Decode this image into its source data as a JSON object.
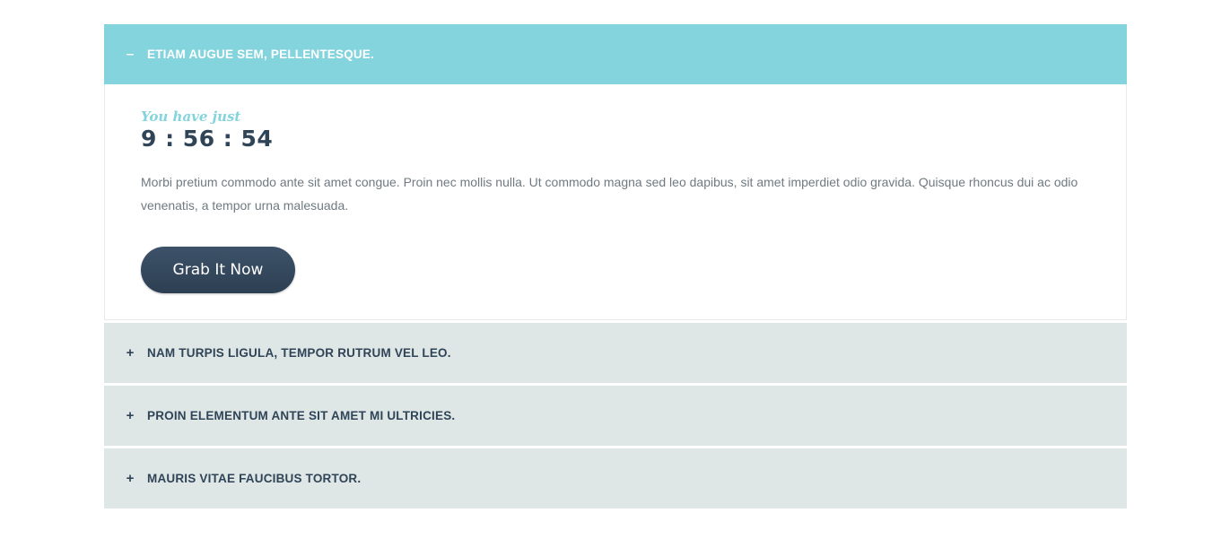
{
  "accordion": {
    "open_item": {
      "icon": "minus-icon",
      "icon_glyph": "–",
      "title": "Etiam augue sem, pellentesque.",
      "countdown_label": "You have just",
      "countdown_value": "9 : 56 : 54",
      "body": "Morbi pretium commodo ante sit amet congue. Proin nec mollis nulla. Ut commodo magna sed leo dapibus, sit amet imperdiet odio gravida. Quisque rhoncus dui ac odio venenatis, a tempor urna malesuada.",
      "button_label": "Grab It Now"
    },
    "closed_items": [
      {
        "icon": "plus-icon",
        "icon_glyph": "+",
        "title": "Nam turpis ligula, tempor rutrum vel leo."
      },
      {
        "icon": "plus-icon",
        "icon_glyph": "+",
        "title": "Proin elementum ante sit amet mi ultricies."
      },
      {
        "icon": "plus-icon",
        "icon_glyph": "+",
        "title": "Mauris vitae faucibus tortor."
      }
    ]
  },
  "colors": {
    "accent": "#84d4de",
    "closed_header_bg": "#dfe6e6",
    "dark_text": "#2f4457",
    "body_text": "#6f7a80",
    "button_bg": "#2d3f52"
  }
}
